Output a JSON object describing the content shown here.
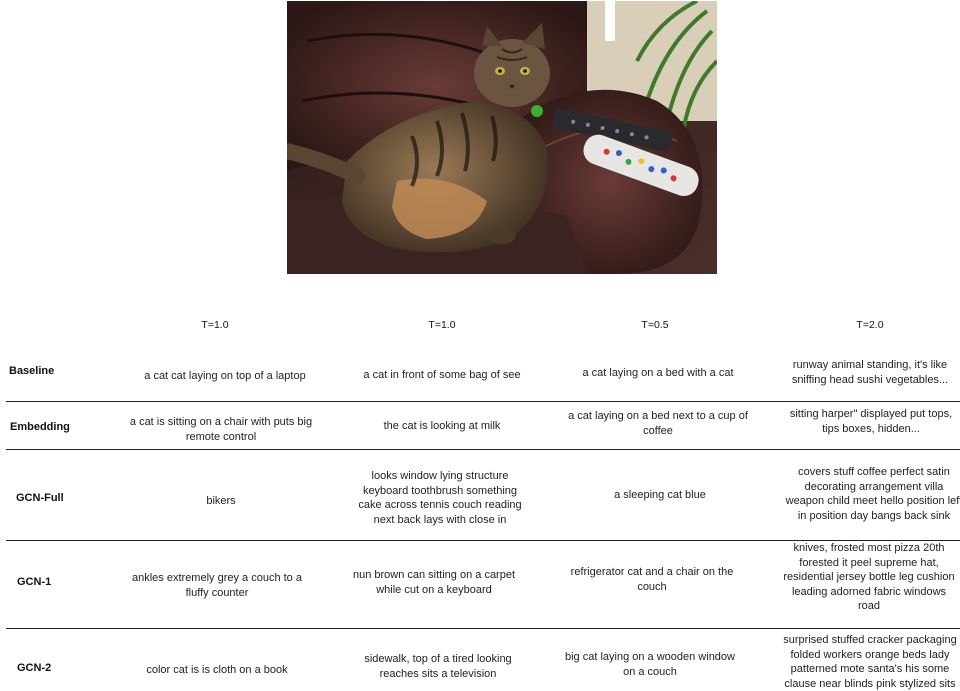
{
  "image_alt": "tabby cat lying on a leather armchair next to two TV remotes",
  "columns": [
    "T=1.0",
    "T=1.0",
    "T=0.5",
    "T=2.0"
  ],
  "rows": [
    {
      "name": "Baseline",
      "cells": [
        "a cat cat laying on top of a laptop",
        "a cat in front of some bag of see",
        "a cat laying on a bed with a cat",
        "runway animal standing, it's like sniffing head sushi vegetables..."
      ]
    },
    {
      "name": "Embedding",
      "cells": [
        "a cat is sitting on a chair with puts big remote control",
        "the cat is looking at milk",
        "a cat laying on a bed next to a cup of coffee",
        "sitting harper\" displayed put tops, tips boxes, hidden..."
      ]
    },
    {
      "name": "GCN-Full",
      "cells": [
        "bikers",
        "looks window lying structure keyboard toothbrush something cake across tennis couch reading next back lays with close in",
        "a sleeping cat blue",
        "covers stuff coffee perfect satin decorating arrangement villa weapon child meet hello position left in position day bangs back sink"
      ]
    },
    {
      "name": "GCN-1",
      "cells": [
        "ankles extremely grey a couch to a fluffy counter",
        "nun brown can sitting on a carpet while cut on a keyboard",
        "refrigerator cat and a chair on the couch",
        "knives, frosted most pizza 20th forested it peel supreme hat, residential jersey bottle leg cushion leading adorned fabric windows road"
      ]
    },
    {
      "name": "GCN-2",
      "cells": [
        "color cat is is cloth on a book",
        "sidewalk, top of a tired looking reaches sits a television",
        "big cat laying on a wooden window on a couch",
        "surprised stuffed cracker packaging folded workers orange beds lady patterned mote santa's his some clause near blinds pink stylized sits"
      ]
    }
  ]
}
